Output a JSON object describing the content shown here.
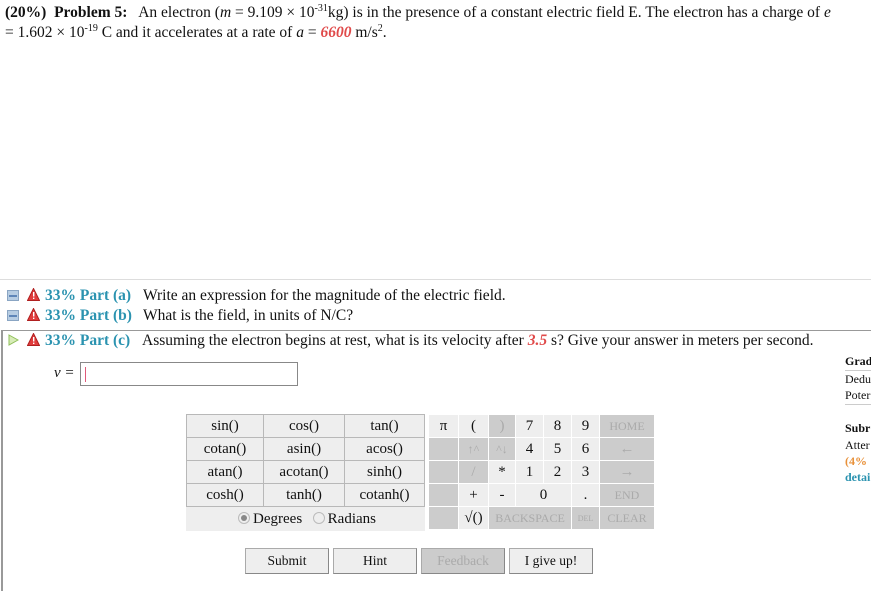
{
  "problem": {
    "weight": "(20%)",
    "title": "Problem 5:",
    "text_1": "An electron (",
    "m_symbol": "m",
    "text_2": " = 9.109 × 10",
    "exp_mass": "-31",
    "text_3": "kg) is in the presence of a constant electric field E. The electron has a charge of ",
    "e_symbol": "e",
    "text_4": "= 1.602 × 10",
    "exp_charge": "-19",
    "text_5": " C and it accelerates at a rate of ",
    "a_symbol": "a",
    "text_6": " = ",
    "accel_value": "6600",
    "text_7": " m/s",
    "exp_unit": "2",
    "text_8": "."
  },
  "parts": [
    {
      "percent_label": "33% Part (a)",
      "text": "Write an expression for the magnitude of the electric field.",
      "state": "collapsed"
    },
    {
      "percent_label": "33% Part (b)",
      "text": "What is the field, in units of N/C?",
      "state": "collapsed"
    },
    {
      "percent_label": "33% Part (c)",
      "text_1": "Assuming the electron begins at rest, what is its velocity after ",
      "time_value": "3.5",
      "text_2": " s? Give your answer in meters per second.",
      "state": "expanded"
    }
  ],
  "answer": {
    "label": "v =",
    "value": ""
  },
  "sidebar": {
    "grade_header": "Grad",
    "deductions": "Dedu",
    "potential": "Poter",
    "submissions_header": "Subr",
    "attempts": "Atter",
    "attempt_pct": "(4%",
    "details_link": "detai"
  },
  "functions": [
    [
      "sin()",
      "cos()",
      "tan()"
    ],
    [
      "cotan()",
      "asin()",
      "acos()"
    ],
    [
      "atan()",
      "acotan()",
      "sinh()"
    ],
    [
      "cosh()",
      "tanh()",
      "cotanh()"
    ]
  ],
  "angle_mode": {
    "degrees": "Degrees",
    "radians": "Radians",
    "selected": "Degrees"
  },
  "keypad": {
    "pi": "π",
    "lparen": "(",
    "rparen": ")",
    "k7": "7",
    "k8": "8",
    "k9": "9",
    "home": "HOME",
    "up_pow": "↑^",
    "down_pow": "^↓",
    "k4": "4",
    "k5": "5",
    "k6": "6",
    "left": "←",
    "divide": "/",
    "multiply": "*",
    "k1": "1",
    "k2": "2",
    "k3": "3",
    "right": "→",
    "plus": "+",
    "minus": "-",
    "k0": "0",
    "dot": ".",
    "end": "END",
    "sqrt": "√()",
    "backspace": "BACKSPACE",
    "del": "DEL",
    "clear": "CLEAR"
  },
  "buttons": {
    "submit": "Submit",
    "hint": "Hint",
    "feedback": "Feedback",
    "give_up": "I give up!"
  },
  "colors": {
    "part_label": "#2b93b0",
    "highlight_value": "#e04a4a",
    "warning": "#e03c3c"
  }
}
